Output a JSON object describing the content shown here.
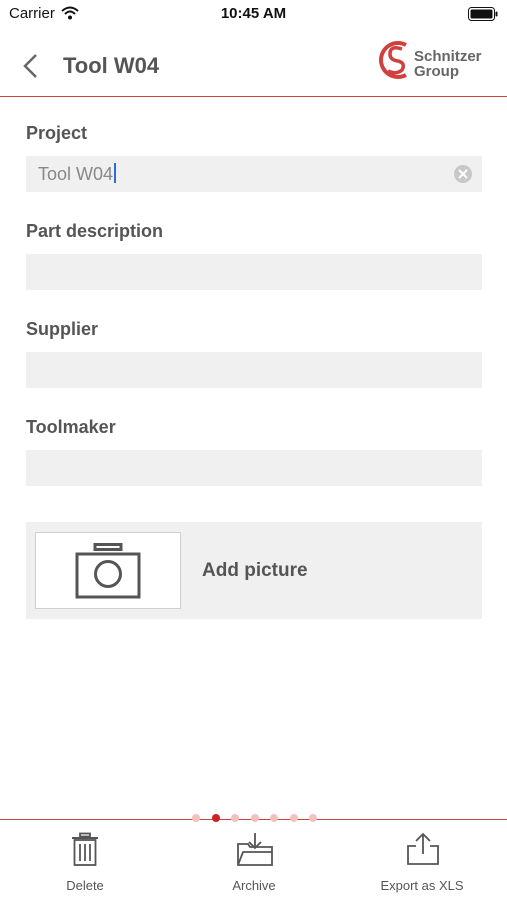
{
  "status_bar": {
    "carrier": "Carrier",
    "time": "10:45 AM"
  },
  "nav": {
    "title": "Tool W04",
    "logo_line1": "Schnitzer",
    "logo_line2": "Group",
    "brand_color": "#d0403c"
  },
  "form": {
    "project_label": "Project",
    "project_value": "Tool W04",
    "part_label": "Part description",
    "part_value": "",
    "supplier_label": "Supplier",
    "supplier_value": "",
    "toolmaker_label": "Toolmaker",
    "toolmaker_value": ""
  },
  "picture": {
    "add_label": "Add picture"
  },
  "pager": {
    "count": 7,
    "active_index": 1
  },
  "toolbar": {
    "delete_label": "Delete",
    "archive_label": "Archive",
    "export_label": "Export as XLS"
  },
  "icons": [
    "wifi-icon",
    "battery-icon",
    "back-chevron-icon",
    "schnitzer-logo-icon",
    "clear-icon",
    "camera-icon",
    "trash-icon",
    "archive-icon",
    "share-icon"
  ]
}
